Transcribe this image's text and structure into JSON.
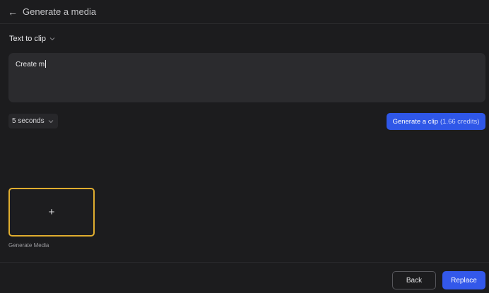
{
  "header": {
    "back_icon": "arrow-left-icon",
    "title": "Generate a media"
  },
  "mode_select": {
    "value": "Text to clip",
    "icon": "chevron-down-icon"
  },
  "prompt": {
    "value": "Create m"
  },
  "duration_select": {
    "value": "5 seconds",
    "icon": "chevron-down-icon"
  },
  "generate_button": {
    "label": "Generate a clip",
    "credits": "(1.66 credits)"
  },
  "media_tile": {
    "icon": "plus-icon",
    "label": "Generate Media"
  },
  "footer": {
    "back_label": "Back",
    "replace_label": "Replace"
  },
  "colors": {
    "background": "#1c1c1e",
    "accent": "#2f57e8",
    "tile_border": "#e0ad2f"
  }
}
